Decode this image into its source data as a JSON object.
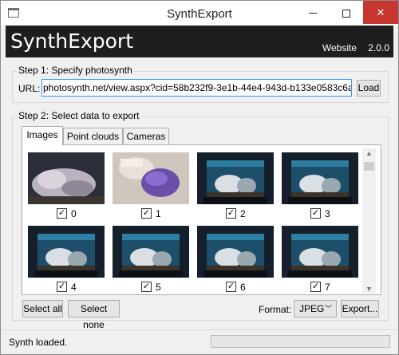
{
  "window": {
    "title": "SynthExport",
    "minimize_glyph": "",
    "close_glyph": "✕"
  },
  "header": {
    "app_name": "SynthExport",
    "website_label": "Website",
    "version": "2.0.0"
  },
  "step1": {
    "title": "Step 1: Specify photosynth",
    "url_label": "URL:",
    "url_value": "photosynth.net/view.aspx?cid=58b232f9-3e1b-44e4-943d-b133e0583c6a",
    "load_label": "Load"
  },
  "step2": {
    "title": "Step 2: Select data to export",
    "tabs": [
      {
        "label": "Images",
        "selected": true
      },
      {
        "label": "Point clouds",
        "selected": false
      },
      {
        "label": "Cameras",
        "selected": false
      }
    ],
    "images": [
      {
        "label": "0",
        "checked": true,
        "scene": "coral"
      },
      {
        "label": "1",
        "checked": true,
        "scene": "anemone"
      },
      {
        "label": "2",
        "checked": true,
        "scene": "aquarium"
      },
      {
        "label": "3",
        "checked": true,
        "scene": "aquarium"
      },
      {
        "label": "4",
        "checked": true,
        "scene": "aquarium"
      },
      {
        "label": "5",
        "checked": true,
        "scene": "aquarium"
      },
      {
        "label": "6",
        "checked": true,
        "scene": "aquarium"
      },
      {
        "label": "7",
        "checked": true,
        "scene": "aquarium"
      }
    ],
    "check_glyph": "✓",
    "select_all_label": "Select all",
    "select_none_label": "Select none",
    "format_label": "Format:",
    "format_value": "JPEG",
    "export_label": "Export..."
  },
  "status": {
    "text": "Synth loaded.",
    "progress": 0
  },
  "colors": {
    "header_bg": "#1e1e1e",
    "close_button": "#c7372f",
    "input_focus_border": "#3399ff"
  }
}
